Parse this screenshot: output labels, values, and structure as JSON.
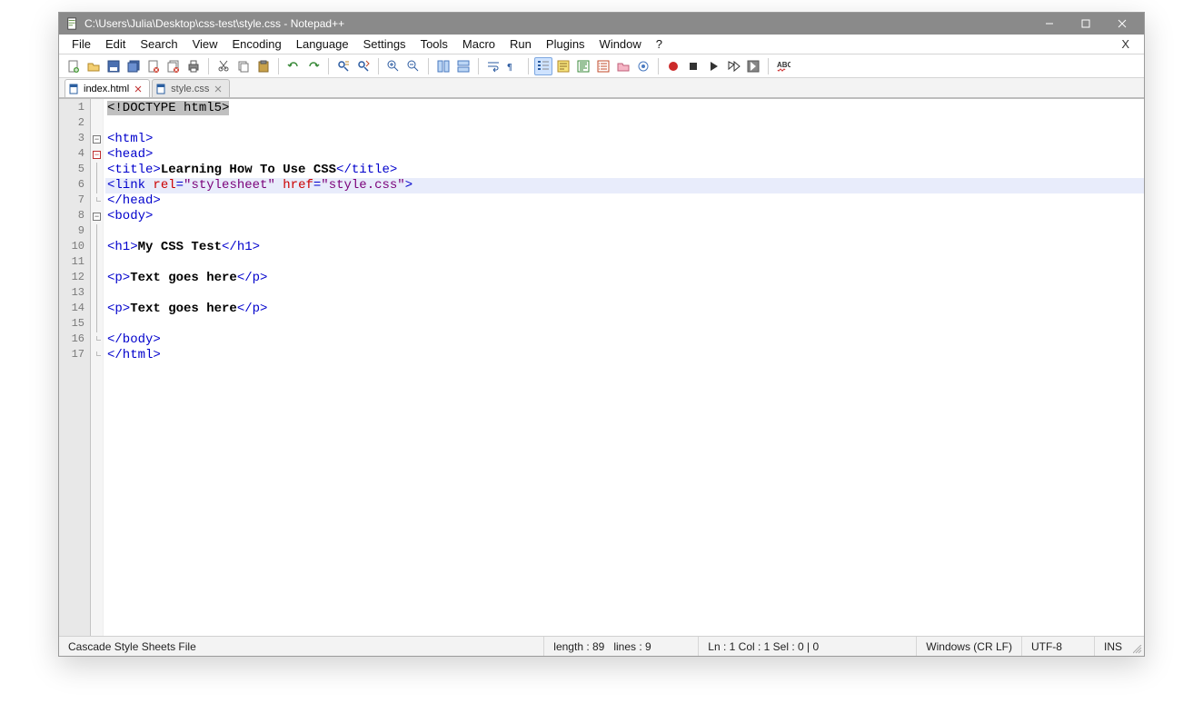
{
  "title": "C:\\Users\\Julia\\Desktop\\css-test\\style.css - Notepad++",
  "menus": [
    "File",
    "Edit",
    "Search",
    "View",
    "Encoding",
    "Language",
    "Settings",
    "Tools",
    "Macro",
    "Run",
    "Plugins",
    "Window",
    "?"
  ],
  "menu_close": "X",
  "tabs": [
    {
      "label": "index.html",
      "active": true
    },
    {
      "label": "style.css",
      "active": false
    }
  ],
  "line_count": 17,
  "code_lines": [
    {
      "n": 1,
      "type": "doctype",
      "fold": "",
      "sel": true
    },
    {
      "n": 2,
      "type": "blank",
      "fold": ""
    },
    {
      "n": 3,
      "type": "open",
      "fold": "box",
      "tag": "html"
    },
    {
      "n": 4,
      "type": "open",
      "fold": "boxred",
      "tag": "head"
    },
    {
      "n": 5,
      "type": "title",
      "fold": "line",
      "text": "Learning How To Use CSS"
    },
    {
      "n": 6,
      "type": "link",
      "fold": "line",
      "current": true,
      "attrs": [
        {
          "name": "rel",
          "value": "stylesheet"
        },
        {
          "name": "href",
          "value": "style.css"
        }
      ]
    },
    {
      "n": 7,
      "type": "close",
      "fold": "corner",
      "tag": "head"
    },
    {
      "n": 8,
      "type": "open",
      "fold": "box",
      "tag": "body"
    },
    {
      "n": 9,
      "type": "blank",
      "fold": "line"
    },
    {
      "n": 10,
      "type": "h1",
      "fold": "line",
      "text": "My CSS Test"
    },
    {
      "n": 11,
      "type": "blank",
      "fold": "line"
    },
    {
      "n": 12,
      "type": "p",
      "fold": "line",
      "text": "Text goes here"
    },
    {
      "n": 13,
      "type": "blank",
      "fold": "line"
    },
    {
      "n": 14,
      "type": "p",
      "fold": "line",
      "text": "Text goes here"
    },
    {
      "n": 15,
      "type": "blank",
      "fold": "line"
    },
    {
      "n": 16,
      "type": "close",
      "fold": "corner",
      "tag": "body"
    },
    {
      "n": 17,
      "type": "close",
      "fold": "corner",
      "tag": "html"
    }
  ],
  "doctype_text": "<!DOCTYPE html5>",
  "status": {
    "filetype": "Cascade Style Sheets File",
    "length_label": "length : 89",
    "lines_label": "lines : 9",
    "pos_label": "Ln : 1   Col : 1   Sel : 0 | 0",
    "eol": "Windows (CR LF)",
    "encoding": "UTF-8",
    "mode": "INS"
  },
  "toolbar_names": [
    "new-file",
    "open-file",
    "save",
    "save-all",
    "close",
    "close-all",
    "print",
    "cut",
    "copy",
    "paste",
    "undo",
    "redo",
    "find",
    "find-replace",
    "zoom-in",
    "zoom-out",
    "sync-v",
    "sync-h",
    "word-wrap",
    "show-all-chars",
    "indent-guide",
    "lang-udl",
    "doc-map",
    "func-list",
    "folder-as-workspace",
    "monitor",
    "record-macro",
    "stop-macro",
    "play-macro",
    "play-multi",
    "save-macro",
    "spell-check"
  ],
  "active_toolbar": "indent-guide",
  "colors": {
    "titlebar": "#8a8a8a",
    "tag": "#0000cc",
    "attr": "#cc0000",
    "string": "#7a007a",
    "current_line": "#e8ecfb",
    "selection": "#c0c0c0"
  }
}
